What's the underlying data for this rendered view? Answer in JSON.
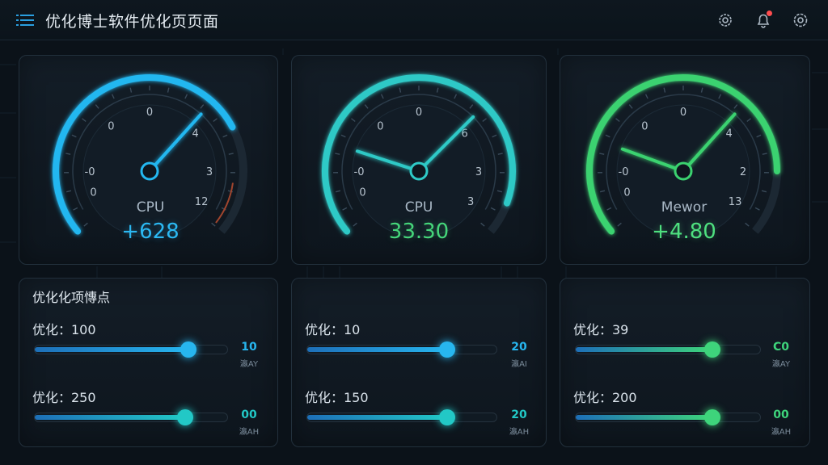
{
  "header": {
    "title": "优化博士软件优化页页面",
    "icons": [
      "menu-icon",
      "gear-icon",
      "bell-icon",
      "settings-icon"
    ]
  },
  "gauges": [
    {
      "label": "CPU",
      "value": "+628",
      "ticks": [
        "0",
        "-0",
        "0",
        "0",
        "4",
        "3",
        "12"
      ],
      "accent": "#23b7f0",
      "value_color": "#2bb8f2"
    },
    {
      "label": "CPU",
      "value": "33.30",
      "ticks": [
        "0",
        "-0",
        "0",
        "0",
        "6",
        "3",
        "3"
      ],
      "accent": "#2ec9c6",
      "value_color": "#45d57a"
    },
    {
      "label": "Mewor",
      "value": "+4.80",
      "ticks": [
        "0",
        "-0",
        "0",
        "0",
        "4",
        "2",
        "13"
      ],
      "accent": "#3bd26f",
      "value_color": "#4ee07f"
    }
  ],
  "panels": [
    {
      "title": "优化化项慱点",
      "sliders": [
        {
          "label": "优化：100",
          "value": "10",
          "unit": "瀛AY",
          "level": 0.8,
          "color": "#27b6ef"
        },
        {
          "label": "优化：250",
          "value": "00",
          "unit": "瀛AH",
          "level": 0.78,
          "color": "#22c8c6"
        }
      ]
    },
    {
      "title": "",
      "sliders": [
        {
          "label": "优化：10",
          "value": "20",
          "unit": "瀛AI",
          "level": 0.74,
          "color": "#27b6ef"
        },
        {
          "label": "优化：150",
          "value": "20",
          "unit": "瀛AH",
          "level": 0.74,
          "color": "#22c8c6"
        }
      ]
    },
    {
      "title": "",
      "sliders": [
        {
          "label": "优化：39",
          "value": "C0",
          "unit": "瀛AY",
          "level": 0.74,
          "color": "#3ed47b"
        },
        {
          "label": "优化：200",
          "value": "00",
          "unit": "瀛AH",
          "level": 0.74,
          "color": "#3ed47b"
        }
      ]
    }
  ]
}
